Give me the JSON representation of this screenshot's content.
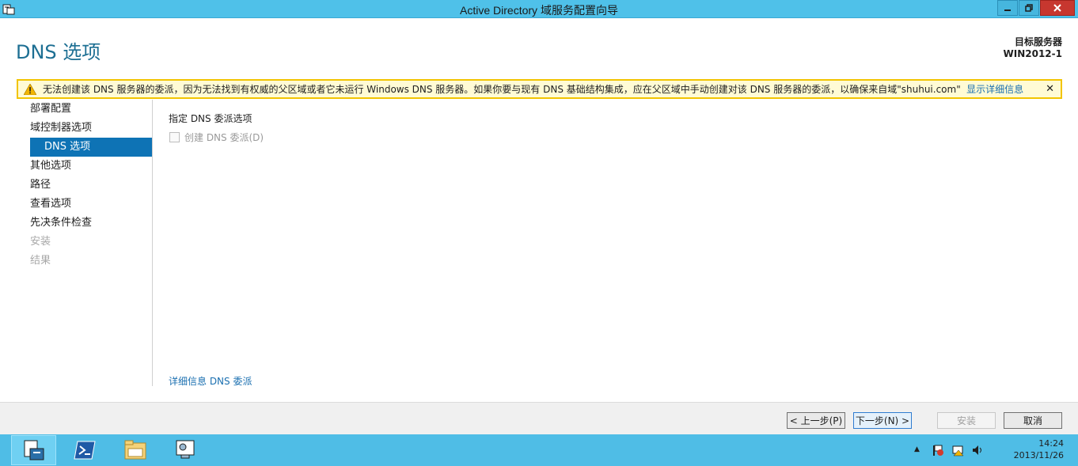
{
  "window": {
    "title": "Active Directory 域服务配置向导"
  },
  "header": {
    "page_title": "DNS 选项",
    "target_label": "目标服务器",
    "target_value": "WIN2012-1"
  },
  "warning": {
    "message": "无法创建该 DNS 服务器的委派，因为无法找到有权威的父区域或者它未运行 Windows DNS 服务器。如果你要与现有 DNS 基础结构集成，应在父区域中手动创建对该 DNS 服务器的委派，以确保来自域\"shuhui.com\"...",
    "details_link": "显示详细信息",
    "close_glyph": "✕"
  },
  "nav": {
    "items": [
      {
        "label": "部署配置",
        "state": "normal"
      },
      {
        "label": "域控制器选项",
        "state": "normal"
      },
      {
        "label": "DNS 选项",
        "state": "active"
      },
      {
        "label": "其他选项",
        "state": "normal"
      },
      {
        "label": "路径",
        "state": "normal"
      },
      {
        "label": "查看选项",
        "state": "normal"
      },
      {
        "label": "先决条件检查",
        "state": "normal"
      },
      {
        "label": "安装",
        "state": "disabled"
      },
      {
        "label": "结果",
        "state": "disabled"
      }
    ]
  },
  "content": {
    "heading": "指定 DNS 委派选项",
    "checkbox_label": "创建 DNS 委派(D)",
    "checkbox_checked": false,
    "more_link": "详细信息 DNS 委派"
  },
  "buttons": {
    "prev": "< 上一步(P)",
    "next": "下一步(N) >",
    "install": "安装",
    "cancel": "取消"
  },
  "taskbar": {
    "clock_time": "14:24",
    "clock_date": "2013/11/26"
  },
  "colors": {
    "titlebar": "#4fc1e9",
    "accent": "#0e73b5",
    "page_title": "#1d6f93",
    "warning_border": "#f2c400",
    "link": "#1a6fb0"
  }
}
